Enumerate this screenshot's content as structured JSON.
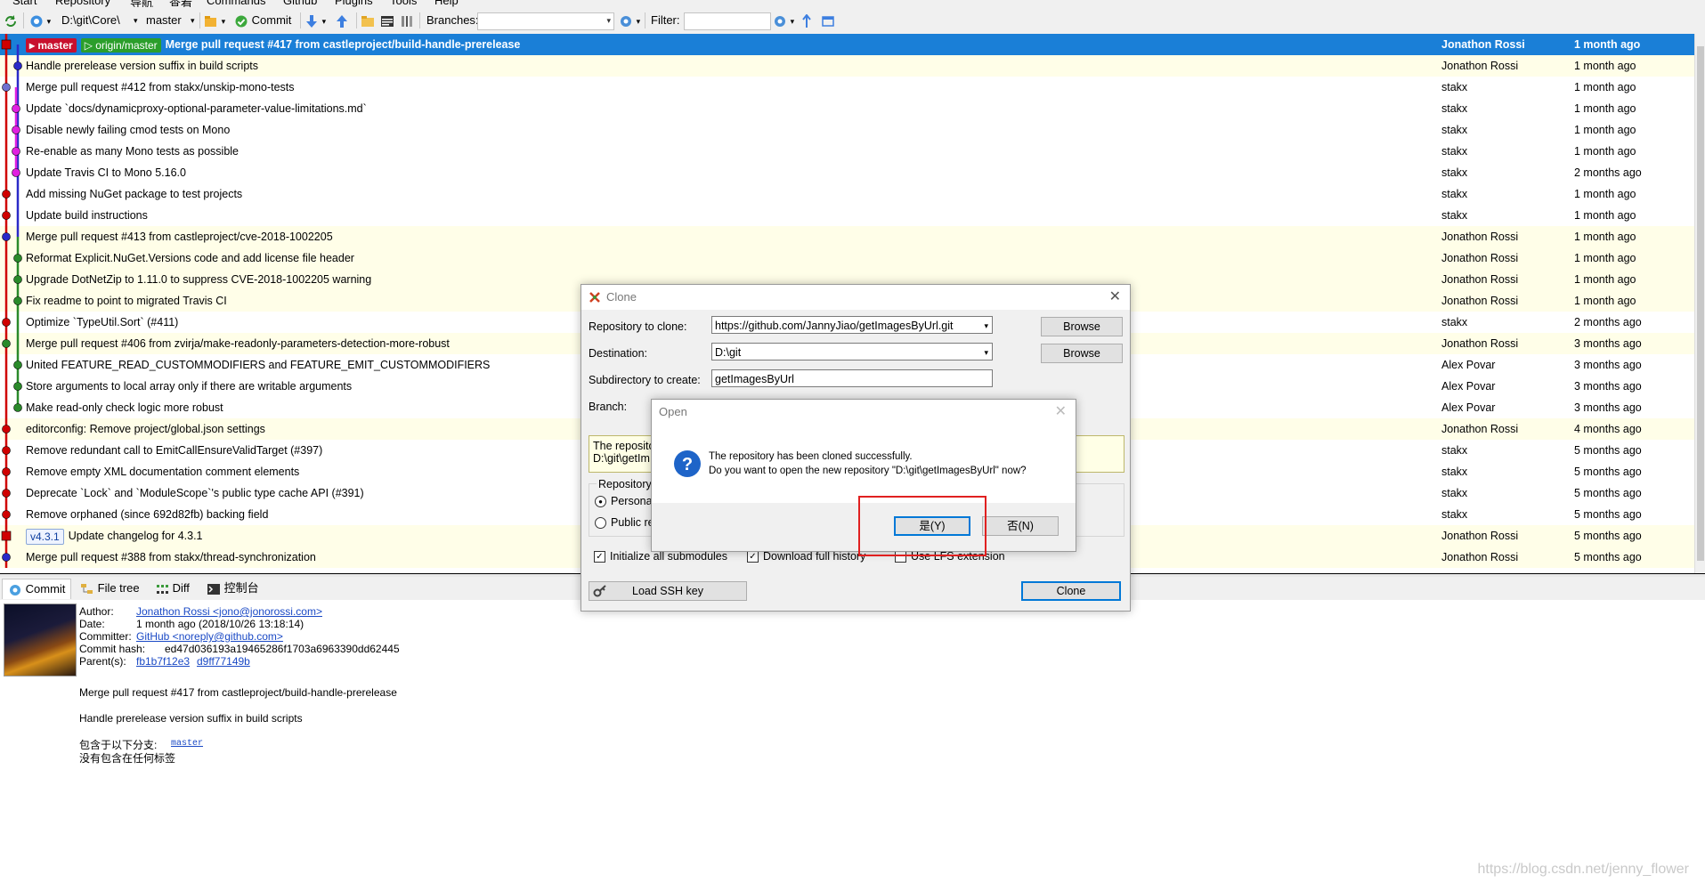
{
  "menu": {
    "items": [
      "Start",
      "Repository",
      "导航",
      "查看",
      "Commands",
      "Github",
      "Plugins",
      "Tools",
      "Help"
    ]
  },
  "toolbar": {
    "repo_path": "D:\\git\\Core\\",
    "branch": "master",
    "commit_label": "Commit",
    "branches_label": "Branches:",
    "filter_label": "Filter:"
  },
  "commits": [
    {
      "msg": "Merge pull request #417 from castleproject/build-handle-prerelease",
      "author": "Jonathon Rossi",
      "date": "1 month ago",
      "refs": [
        {
          "text": "▸ master",
          "kind": "red"
        },
        {
          "text": "▷ origin/master",
          "kind": "green"
        }
      ],
      "selected": true
    },
    {
      "msg": "Handle prerelease version suffix in build scripts",
      "author": "Jonathon Rossi",
      "date": "1 month ago",
      "yellow": true
    },
    {
      "msg": "Merge pull request #412 from stakx/unskip-mono-tests",
      "author": "stakx",
      "date": "1 month ago"
    },
    {
      "msg": "Update `docs/dynamicproxy-optional-parameter-value-limitations.md`",
      "author": "stakx",
      "date": "1 month ago"
    },
    {
      "msg": "Disable newly failing cmod tests on Mono",
      "author": "stakx",
      "date": "1 month ago"
    },
    {
      "msg": "Re-enable as many Mono tests as possible",
      "author": "stakx",
      "date": "1 month ago"
    },
    {
      "msg": "Update Travis CI to Mono 5.16.0",
      "author": "stakx",
      "date": "2 months ago"
    },
    {
      "msg": "Add missing NuGet package to test projects",
      "author": "stakx",
      "date": "1 month ago"
    },
    {
      "msg": "Update build instructions",
      "author": "stakx",
      "date": "1 month ago"
    },
    {
      "msg": "Merge pull request #413 from castleproject/cve-2018-1002205",
      "author": "Jonathon Rossi",
      "date": "1 month ago",
      "yellow": true
    },
    {
      "msg": "Reformat Explicit.NuGet.Versions code and add license file header",
      "author": "Jonathon Rossi",
      "date": "1 month ago",
      "yellow": true
    },
    {
      "msg": "Upgrade DotNetZip to 1.11.0 to suppress CVE-2018-1002205 warning",
      "author": "Jonathon Rossi",
      "date": "1 month ago",
      "yellow": true
    },
    {
      "msg": "Fix readme to point to migrated Travis CI",
      "author": "Jonathon Rossi",
      "date": "1 month ago",
      "yellow": true
    },
    {
      "msg": "Optimize `TypeUtil.Sort` (#411)",
      "author": "stakx",
      "date": "2 months ago"
    },
    {
      "msg": "Merge pull request #406 from zvirja/make-readonly-parameters-detection-more-robust",
      "author": "Jonathon Rossi",
      "date": "3 months ago",
      "yellow": true
    },
    {
      "msg": "United FEATURE_READ_CUSTOMMODIFIERS and FEATURE_EMIT_CUSTOMMODIFIERS",
      "author": "Alex Povar",
      "date": "3 months ago"
    },
    {
      "msg": "Store arguments to local array only if there are writable arguments",
      "author": "Alex Povar",
      "date": "3 months ago"
    },
    {
      "msg": "Make read-only check logic more robust",
      "author": "Alex Povar",
      "date": "3 months ago"
    },
    {
      "msg": "editorconfig: Remove project/global.json settings",
      "author": "Jonathon Rossi",
      "date": "4 months ago",
      "yellow": true
    },
    {
      "msg": "Remove redundant call to EmitCallEnsureValidTarget (#397)",
      "author": "stakx",
      "date": "5 months ago"
    },
    {
      "msg": "Remove empty XML documentation comment elements",
      "author": "stakx",
      "date": "5 months ago"
    },
    {
      "msg": "Deprecate `Lock` and `ModuleScope`'s public type cache API (#391)",
      "author": "stakx",
      "date": "5 months ago"
    },
    {
      "msg": "Remove orphaned (since 692d82fb) backing field",
      "author": "stakx",
      "date": "5 months ago"
    },
    {
      "msg": "Update changelog for 4.3.1",
      "author": "Jonathon Rossi",
      "date": "5 months ago",
      "yellow": true,
      "refs": [
        {
          "text": "v4.3.1",
          "kind": "tag"
        }
      ]
    },
    {
      "msg": "Merge pull request #388 from stakx/thread-synchronization",
      "author": "Jonathon Rossi",
      "date": "5 months ago",
      "yellow": true
    }
  ],
  "tabs": [
    {
      "label": "Commit",
      "icon": "commit-icon"
    },
    {
      "label": "File tree",
      "icon": "file-tree-icon"
    },
    {
      "label": "Diff",
      "icon": "diff-icon"
    },
    {
      "label": "控制台",
      "icon": "console-icon"
    }
  ],
  "details": {
    "author_label": "Author:",
    "author_value": "Jonathon Rossi <jono@jonorossi.com>",
    "date_label": "Date:",
    "date_value": "1 month ago (2018/10/26 13:18:14)",
    "committer_label": "Committer:",
    "committer_value": "GitHub <noreply@github.com>",
    "hash_label": "Commit hash:",
    "hash_value": "ed47d036193a19465286f1703a6963390dd62445",
    "parents_label": "Parent(s):",
    "parent1": "fb1b7f12e3",
    "parent2": "d9ff77149b",
    "message_line1": "Merge pull request #417 from castleproject/build-handle-prerelease",
    "message_line2": "Handle prerelease version suffix in build scripts",
    "branches_label": "包含于以下分支:",
    "branch_link": "master",
    "tags_text": "没有包含在任何标签"
  },
  "clone_dialog": {
    "title": "Clone",
    "repo_label": "Repository to clone:",
    "repo_value": "https://github.com/JannyJiao/getImagesByUrl.git",
    "dest_label": "Destination:",
    "dest_value": "D:\\git",
    "subdir_label": "Subdirectory to create:",
    "subdir_value": "getImagesByUrl",
    "branch_label": "Branch:",
    "browse": "Browse",
    "info_line1": "The reposito",
    "info_line2": "D:\\git\\getIm",
    "repo_type_label": "Repository",
    "personal_label": "Personal",
    "public_label": "Public re",
    "init_submodules": "Initialize all submodules",
    "download_history": "Download full history",
    "use_lfs": "Use LFS extension",
    "load_ssh": "Load SSH key",
    "clone_button": "Clone"
  },
  "open_dialog": {
    "title": "Open",
    "line1": "The repository has been cloned successfully.",
    "line2": "Do you want to open the new repository \"D:\\git\\getImagesByUrl\" now?",
    "yes": "是(Y)",
    "no": "否(N)"
  },
  "watermark": "https://blog.csdn.net/jenny_flower"
}
